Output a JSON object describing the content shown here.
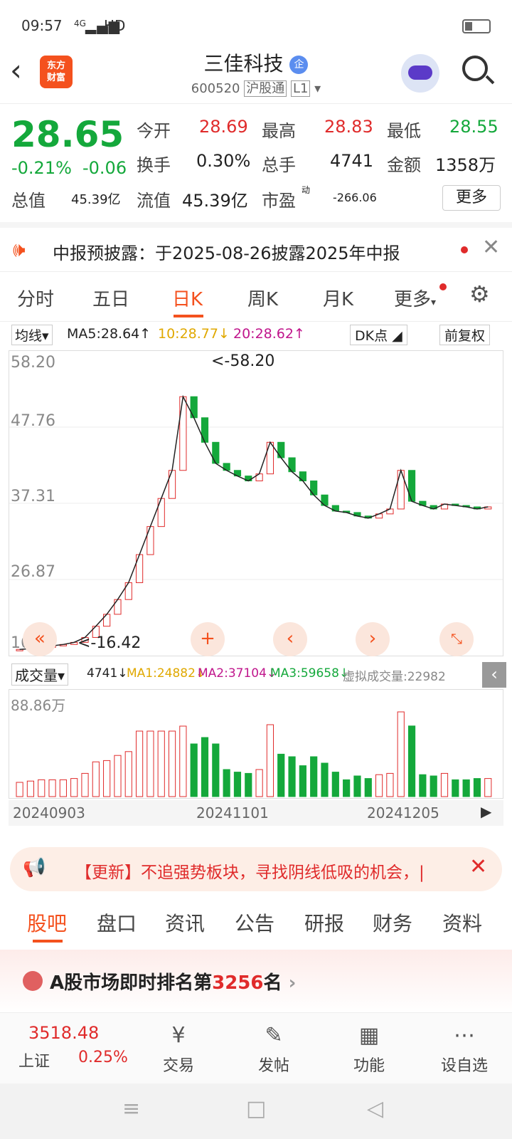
{
  "status": {
    "time": "09:57",
    "net": "4G",
    "hd": "HD"
  },
  "header": {
    "back_icon": "back-arrow-icon",
    "logo_line1": "东方",
    "logo_line2": "财富",
    "stock_name": "三佳科技",
    "badge": "企",
    "code": "600520",
    "market_tag": "沪股通",
    "level_tag": "L1"
  },
  "quote": {
    "price": "28.65",
    "change_pct": "-0.21%",
    "change": "-0.06",
    "open_label": "今开",
    "open": "28.69",
    "high_label": "最高",
    "high": "28.83",
    "low_label": "最低",
    "low": "28.55",
    "turnover_label": "换手",
    "turnover": "0.30%",
    "volume_label": "总手",
    "volume": "4741",
    "amount_label": "金额",
    "amount": "1358万",
    "mktcap_label": "总值",
    "mktcap": "45.39亿",
    "float_label": "流值",
    "float": "45.39亿",
    "pe_label": "市盈",
    "pe_sup": "动",
    "pe": "-266.06",
    "more": "更多"
  },
  "notice": {
    "text": "中报预披露：于2025-08-26披露2025年中报"
  },
  "tabs": [
    "分时",
    "五日",
    "日K",
    "周K",
    "月K",
    "更多"
  ],
  "ma": {
    "type": "均线",
    "ma5": "MA5:28.64↑",
    "ma10": "10:28.77↓",
    "ma20": "20:28.62↑",
    "dk": "DK点",
    "adj": "前复权"
  },
  "kchart": {
    "y_ticks": [
      "58.20",
      "47.76",
      "37.31",
      "26.87",
      "16.42"
    ],
    "max_label": "<-58.20",
    "min_label": "<-16.42"
  },
  "vol": {
    "type": "成交量",
    "v": "4741↓",
    "ma1": "MA1:24882↓",
    "ma2": "MA2:37104↓",
    "ma3": "MA3:59658↓",
    "virtual": "虚拟成交量:22982",
    "y_top": "88.86万"
  },
  "dates": [
    "20240903",
    "20241101",
    "20241205"
  ],
  "banner": {
    "text": "【更新】不追强势板块，寻找阴线低吸的机会，|"
  },
  "bottom_tabs": [
    "股吧",
    "盘口",
    "资讯",
    "公告",
    "研报",
    "财务",
    "资料"
  ],
  "rank": {
    "text1": "A股市场即时排名第",
    "num": "3256",
    "text2": "名"
  },
  "nav": {
    "index_value": "3518.48",
    "index_name": "上证",
    "index_change": "0.25%",
    "items": [
      "交易",
      "发帖",
      "功能",
      "设自选"
    ]
  },
  "chart_data": {
    "type": "candlestick",
    "y_range": [
      16.42,
      58.2
    ],
    "close": [
      16.5,
      16.6,
      16.8,
      17.0,
      17.2,
      17.5,
      18.2,
      19.8,
      21.5,
      23.6,
      26.0,
      30.0,
      34.0,
      38.0,
      42.0,
      52.5,
      49.5,
      46.0,
      43.0,
      42.0,
      41.2,
      40.5,
      41.5,
      46.0,
      43.8,
      41.8,
      40.5,
      38.5,
      37.0,
      36.2,
      36.0,
      35.5,
      35.2,
      35.8,
      36.5,
      42.0,
      37.6,
      37.0,
      36.5,
      37.2,
      37.0,
      36.8,
      36.5,
      36.8
    ]
  }
}
